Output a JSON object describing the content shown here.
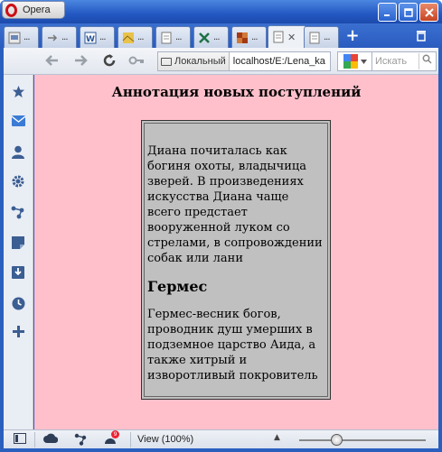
{
  "app": {
    "menu_label": "Opera"
  },
  "tabs": [
    {
      "icon": "page-icon",
      "label": "..."
    },
    {
      "icon": "arrow-icon",
      "label": "..."
    },
    {
      "icon": "word-icon",
      "label": "..."
    },
    {
      "icon": "image-icon",
      "label": "..."
    },
    {
      "icon": "page-icon",
      "label": "..."
    },
    {
      "icon": "excel-icon",
      "label": "..."
    },
    {
      "icon": "image-icon",
      "label": "..."
    },
    {
      "icon": "page-icon",
      "label": "",
      "active": true
    },
    {
      "icon": "page-icon",
      "label": "..."
    }
  ],
  "address": {
    "site_label": "Локальный",
    "url": "localhost/E:/Lena_ka"
  },
  "search": {
    "placeholder": "Искать"
  },
  "page": {
    "title": "Аннотация новых поступлений",
    "paragraph1": "Диана почиталась как богиня охоты, владычица зверей. В произведениях искусства Диана чаще всего предстает вооруженной луком со стрелами, в сопровождении собак или лани",
    "heading2": "Гермес",
    "paragraph2": "Гермес-весник богов, проводник душ умерших в подземное царство Аида, а также хитрый и изворотливый покровитель"
  },
  "statusbar": {
    "zoom_label": "View (100%)",
    "badge_count": "9",
    "zoom_fraction": 0.3
  },
  "colors": {
    "content_bg": "#ffc0cb",
    "article_bg": "#c0c0c0"
  }
}
